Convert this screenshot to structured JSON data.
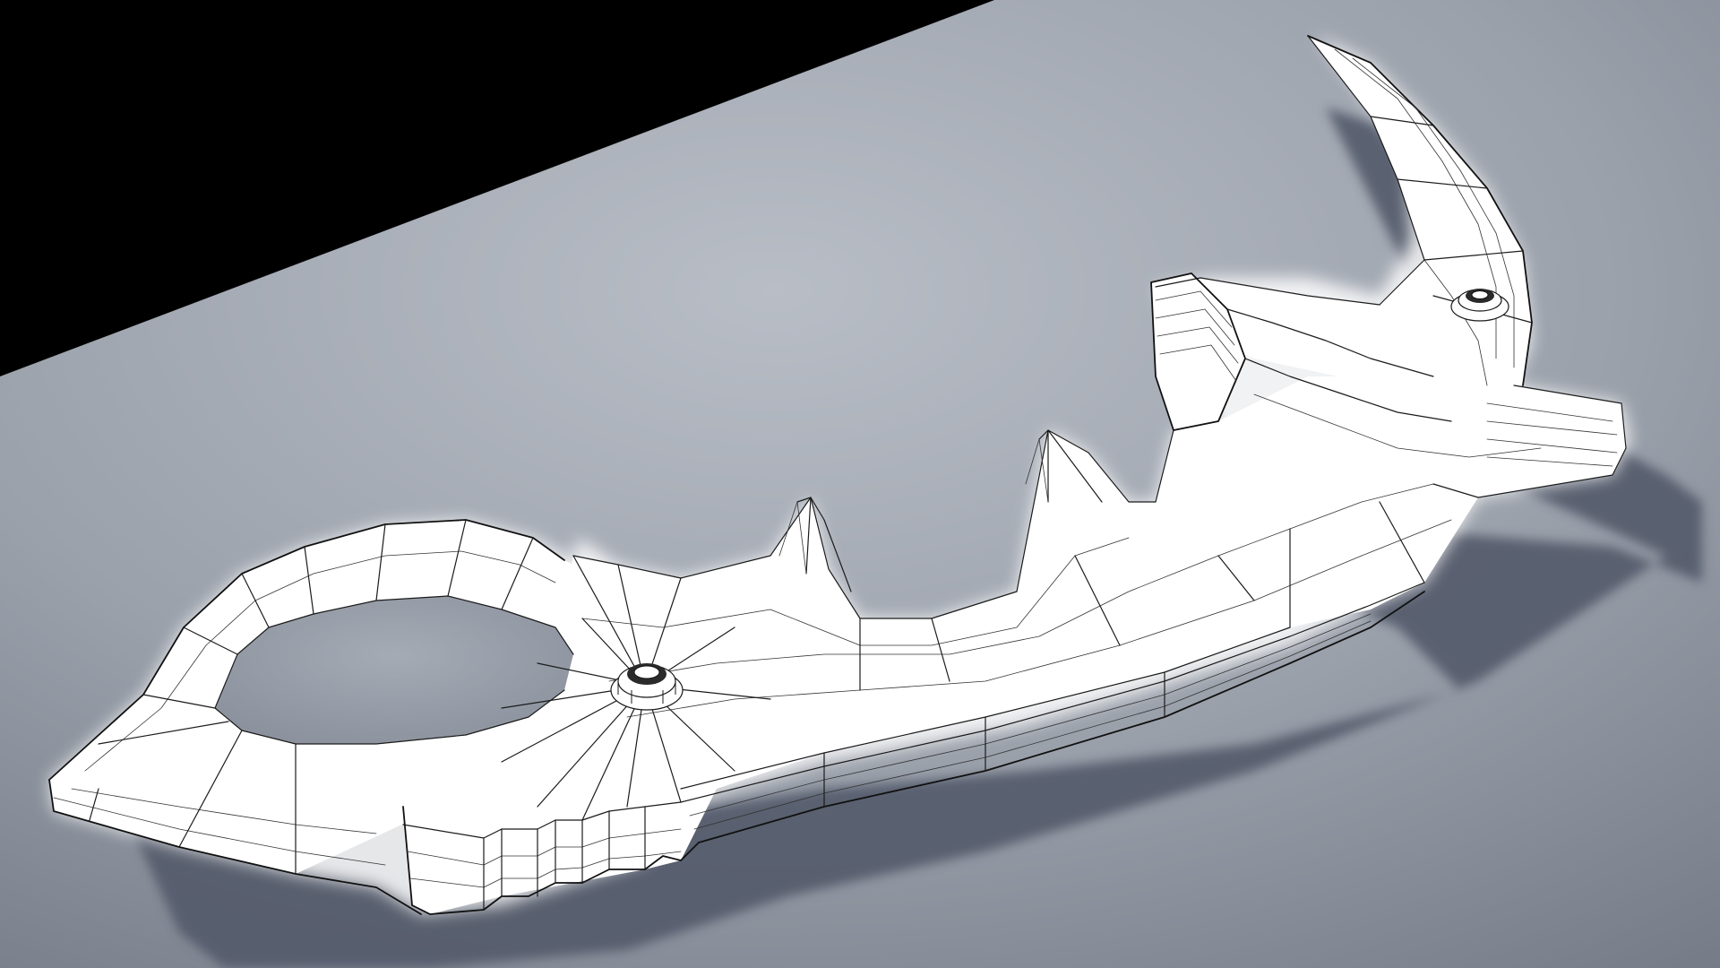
{
  "scene": {
    "subject": "karambit-knife-wireframe-model",
    "colors": {
      "background": "#000000",
      "ground_light": "#b4b9c2",
      "ground_mid": "#9ba1ab",
      "ground_dark": "#7c828e",
      "shadow": "#4e5566",
      "model_fill": "#ffffff",
      "wireframe": "#1b1b1b"
    },
    "features": [
      "finger-ring",
      "handle",
      "blade",
      "pivot-screws",
      "spine-spikes"
    ]
  }
}
